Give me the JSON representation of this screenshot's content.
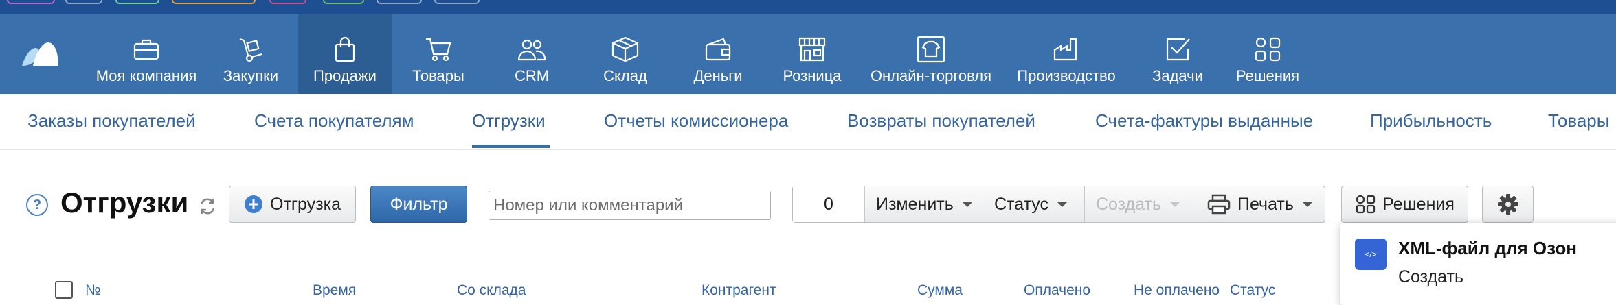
{
  "main_nav": {
    "items": [
      {
        "label": "Моя компания",
        "icon": "briefcase-icon"
      },
      {
        "label": "Закупки",
        "icon": "hand-truck-icon"
      },
      {
        "label": "Продажи",
        "icon": "shopping-bag-icon",
        "active": true
      },
      {
        "label": "Товары",
        "icon": "cart-icon"
      },
      {
        "label": "CRM",
        "icon": "people-icon"
      },
      {
        "label": "Склад",
        "icon": "box-icon"
      },
      {
        "label": "Деньги",
        "icon": "wallet-icon"
      },
      {
        "label": "Розница",
        "icon": "storefront-icon"
      },
      {
        "label": "Онлайн-торговля",
        "icon": "online-shirt-icon"
      },
      {
        "label": "Производство",
        "icon": "factory-icon"
      },
      {
        "label": "Задачи",
        "icon": "task-check-icon"
      },
      {
        "label": "Решения",
        "icon": "apps-grid-icon"
      }
    ]
  },
  "sub_nav": {
    "items": [
      {
        "label": "Заказы покупателей"
      },
      {
        "label": "Счета покупателям"
      },
      {
        "label": "Отгрузки",
        "active": true
      },
      {
        "label": "Отчеты комиссионера"
      },
      {
        "label": "Возвраты покупателей"
      },
      {
        "label": "Счета-фактуры выданные"
      },
      {
        "label": "Прибыльность"
      },
      {
        "label": "Товары"
      }
    ]
  },
  "toolbar": {
    "title": "Отгрузки",
    "add_button_label": "Отгрузка",
    "filter_button_label": "Фильтр",
    "search_placeholder": "Номер или комментарий",
    "selected_count": "0",
    "change_label": "Изменить",
    "status_label": "Статус",
    "create_label": "Создать",
    "print_label": "Печать",
    "solutions_label": "Решения"
  },
  "popup": {
    "title": "XML-файл для Озон",
    "action": "Создать",
    "icon_text": "</>"
  },
  "table": {
    "columns": [
      "№",
      "Время",
      "Со склада",
      "Контрагент",
      "Сумма",
      "Оплачено",
      "Не оплачено",
      "Статус"
    ]
  },
  "colors": {
    "nav_bg": "#3a70ab",
    "nav_active_bg": "#2c5d93",
    "link": "#3465a0",
    "primary_button": "#3a75b6",
    "popup_icon": "#3464d6"
  }
}
